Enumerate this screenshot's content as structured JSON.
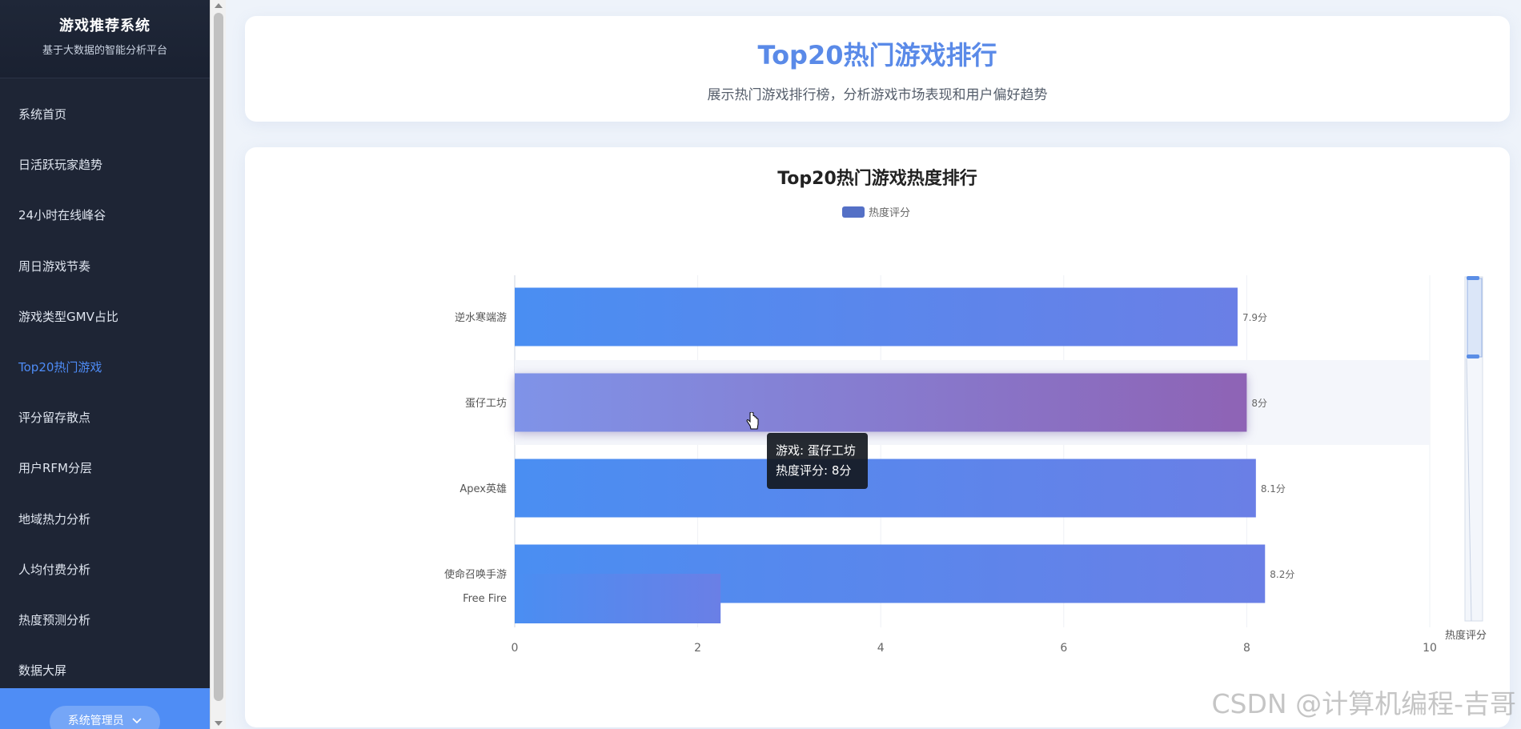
{
  "sidebar": {
    "brand_title": "游戏推荐系统",
    "brand_subtitle": "基于大数据的智能分析平台",
    "items": [
      {
        "label": "系统首页"
      },
      {
        "label": "日活跃玩家趋势"
      },
      {
        "label": "24小时在线峰谷"
      },
      {
        "label": "周日游戏节奏"
      },
      {
        "label": "游戏类型GMV占比"
      },
      {
        "label": "Top20热门游戏",
        "active": true
      },
      {
        "label": "评分留存散点"
      },
      {
        "label": "用户RFM分层"
      },
      {
        "label": "地域热力分析"
      },
      {
        "label": "人均付费分析"
      },
      {
        "label": "热度预测分析"
      },
      {
        "label": "数据大屏"
      }
    ],
    "user_button": "系统管理员"
  },
  "header": {
    "title": "Top20热门游戏排行",
    "subtitle": "展示热门游戏排行榜，分析游戏市场表现和用户偏好趋势"
  },
  "tooltip": {
    "line1": "游戏: 蛋仔工坊",
    "line2": "热度评分: 8分"
  },
  "watermark": "CSDN @计算机编程-吉哥",
  "colors": {
    "accent": "#4e8cf7",
    "bar_start": "#4a8ef2",
    "bar_end": "#6a7fe6",
    "bar_hover_start": "#7f93e8",
    "bar_hover_end": "#8e63b5"
  },
  "chart_data": {
    "type": "bar",
    "orientation": "horizontal",
    "title": "Top20热门游戏热度排行",
    "legend": "热度评分",
    "legend_position": "top-center",
    "categories": [
      "逆水寒端游",
      "蛋仔工坊",
      "Apex英雄",
      "使命召唤手游",
      "Free Fire"
    ],
    "values": [
      7.9,
      8,
      8.1,
      8.2,
      2.25
    ],
    "value_labels": [
      "7.9分",
      "8分",
      "8.1分",
      "8.2分",
      ""
    ],
    "highlighted": "蛋仔工坊",
    "xlim": [
      0,
      10
    ],
    "xticks": [
      "0",
      "2",
      "4",
      "6",
      "8",
      "10"
    ],
    "datazoom_label": "热度评分",
    "grid": true
  }
}
